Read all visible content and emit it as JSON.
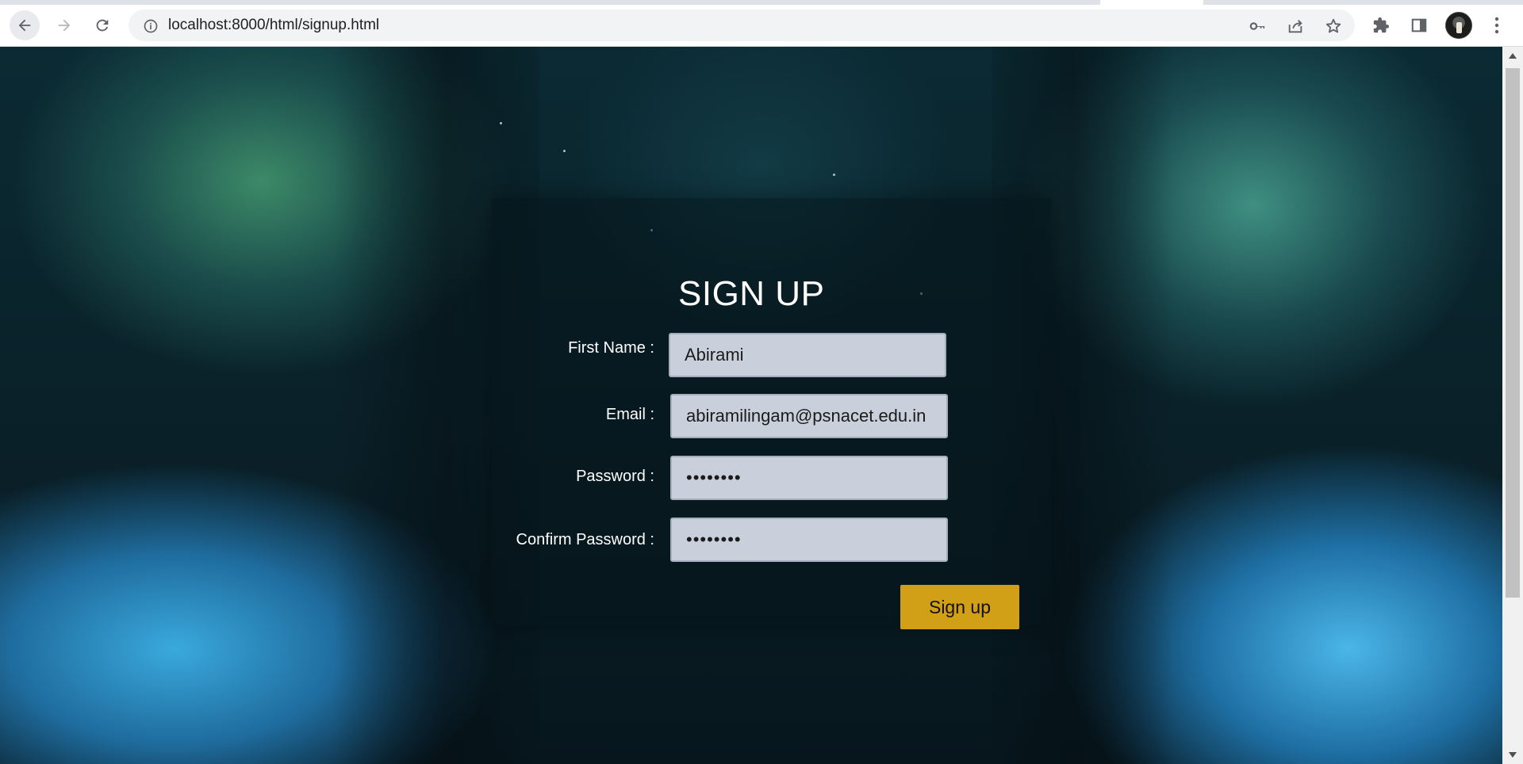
{
  "browser": {
    "url": "localhost:8000/html/signup.html",
    "icons": {
      "back": "arrow-left-icon",
      "forward": "arrow-right-icon",
      "reload": "reload-icon",
      "site_info": "info-icon",
      "password_key": "key-icon",
      "share": "share-icon",
      "bookmark": "star-icon",
      "extensions": "puzzle-icon",
      "side_panel": "side-panel-icon",
      "menu": "kebab-menu-icon"
    }
  },
  "signup": {
    "title": "SIGN UP",
    "fields": {
      "first_name": {
        "label": "First Name :",
        "value": "Abirami"
      },
      "email": {
        "label": "Email :",
        "value": "abiramilingam@psnacet.edu.in"
      },
      "password": {
        "label": "Password :",
        "value": "password"
      },
      "confirm_password": {
        "label": "Confirm Password :",
        "value": "password"
      }
    },
    "submit_label": "Sign up"
  },
  "colors": {
    "button": "#d1a017",
    "input_bg": "#c9d0dc",
    "card_bg": "rgba(6,20,26,0.55)"
  }
}
